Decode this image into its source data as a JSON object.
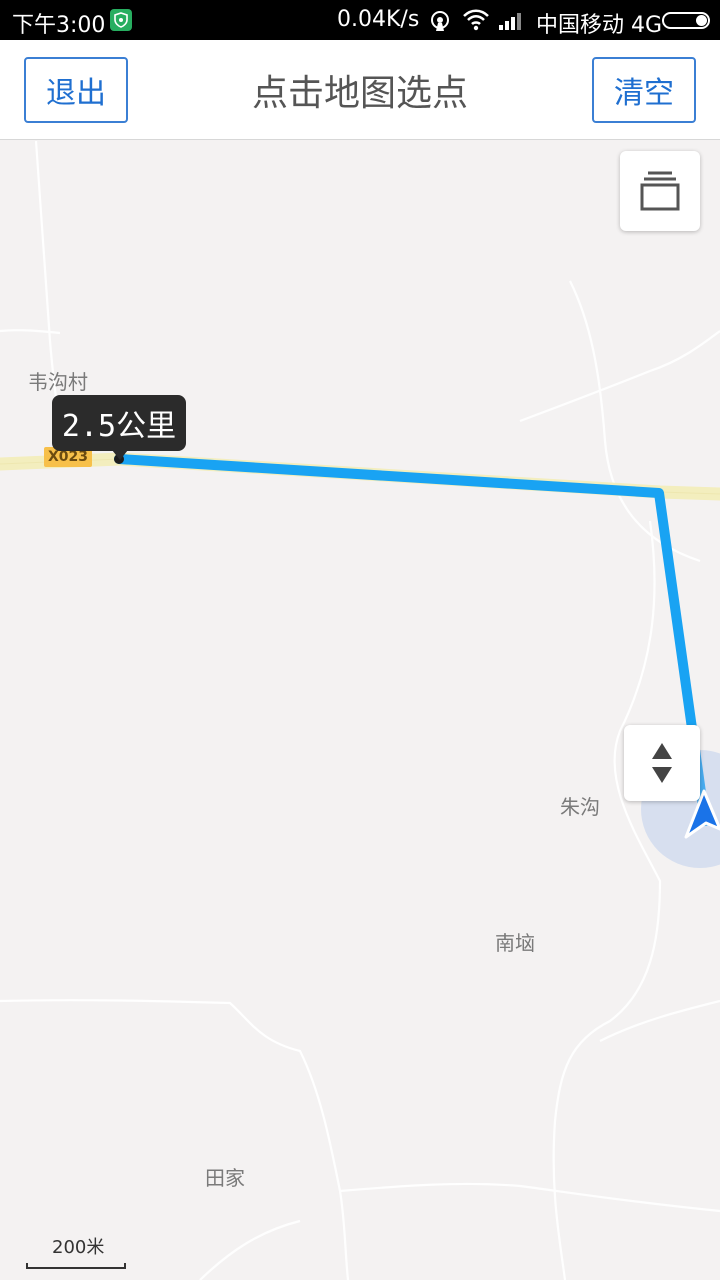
{
  "status_bar": {
    "time": "下午3:00",
    "net_speed": "0.04K/s",
    "carrier": "中国移动 4G"
  },
  "header": {
    "exit_label": "退出",
    "title": "点击地图选点",
    "clear_label": "清空"
  },
  "map": {
    "distance_label": "2.5公里",
    "road_badge": "X023",
    "places": {
      "weigoucun": "韦沟村",
      "zhugou": "朱沟",
      "nanyuan": "南垴",
      "tianjia": "田家"
    },
    "scale_label": "200米",
    "route_color": "#19a3f3",
    "road_color": "#f3eebe"
  }
}
